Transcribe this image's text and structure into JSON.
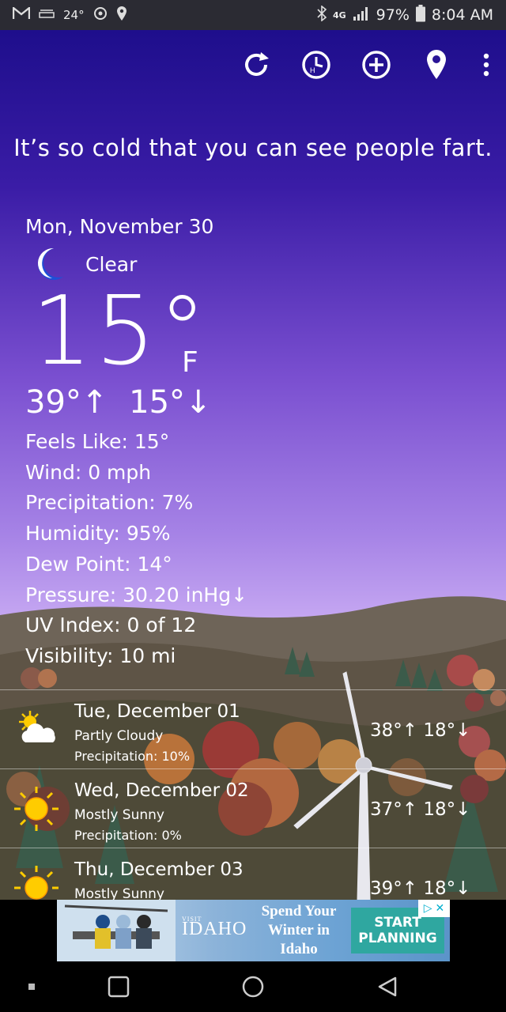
{
  "status_bar": {
    "temp": "24°",
    "battery": "97%",
    "time": "8:04 AM",
    "network": "4G"
  },
  "toolbar": {
    "refresh_icon": "refresh-icon",
    "history_icon": "history-clock-icon",
    "add_icon": "add-location-icon",
    "location_icon": "location-pin-icon",
    "more_icon": "more-vert-icon"
  },
  "quote": "It’s so cold that you can see people fart.",
  "current": {
    "date": "Mon, November 30",
    "condition": "Clear",
    "temp": "15°",
    "unit": "F",
    "high": "39°↑",
    "low": "15°↓",
    "details": [
      "Feels Like: 15°",
      "Wind: 0 mph",
      "Precipitation: 7%",
      "Humidity: 95%",
      "Dew Point: 14°",
      "Pressure: 30.20 inHg↓",
      "UV Index: 0 of 12",
      "Visibility: 10 mi"
    ]
  },
  "forecast": [
    {
      "day": "Tue, December 01",
      "condition": "Partly Cloudy",
      "precip": "Precipitation: 10%",
      "temps": "38°↑ 18°↓",
      "icon": "partly-cloudy-icon"
    },
    {
      "day": "Wed, December 02",
      "condition": "Mostly Sunny",
      "precip": "Precipitation: 0%",
      "temps": "37°↑ 18°↓",
      "icon": "sunny-icon"
    },
    {
      "day": "Thu, December 03",
      "condition": "Mostly Sunny",
      "precip": "",
      "temps": "39°↑ 18°↓",
      "icon": "sunny-icon"
    }
  ],
  "ad": {
    "brand_prefix": "VISIT",
    "brand": "IDAHO",
    "line1": "Spend Your",
    "line2": "Winter in",
    "line3": "Idaho",
    "cta1": "START",
    "cta2": "PLANNING"
  },
  "colors": {
    "sky_top": "#1e0e8c",
    "sky_mid": "#7a4fd0",
    "sky_low": "#c6a8f2",
    "sun": "#ffcc00"
  }
}
